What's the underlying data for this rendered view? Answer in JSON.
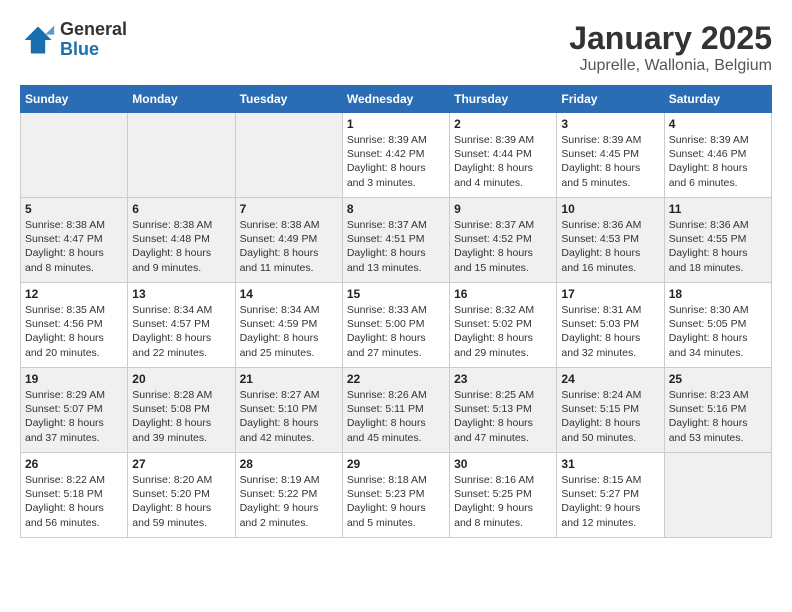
{
  "header": {
    "logo_general": "General",
    "logo_blue": "Blue",
    "month_title": "January 2025",
    "subtitle": "Juprelle, Wallonia, Belgium"
  },
  "weekdays": [
    "Sunday",
    "Monday",
    "Tuesday",
    "Wednesday",
    "Thursday",
    "Friday",
    "Saturday"
  ],
  "weeks": [
    [
      {
        "day": "",
        "info": ""
      },
      {
        "day": "",
        "info": ""
      },
      {
        "day": "",
        "info": ""
      },
      {
        "day": "1",
        "info": "Sunrise: 8:39 AM\nSunset: 4:42 PM\nDaylight: 8 hours\nand 3 minutes."
      },
      {
        "day": "2",
        "info": "Sunrise: 8:39 AM\nSunset: 4:44 PM\nDaylight: 8 hours\nand 4 minutes."
      },
      {
        "day": "3",
        "info": "Sunrise: 8:39 AM\nSunset: 4:45 PM\nDaylight: 8 hours\nand 5 minutes."
      },
      {
        "day": "4",
        "info": "Sunrise: 8:39 AM\nSunset: 4:46 PM\nDaylight: 8 hours\nand 6 minutes."
      }
    ],
    [
      {
        "day": "5",
        "info": "Sunrise: 8:38 AM\nSunset: 4:47 PM\nDaylight: 8 hours\nand 8 minutes."
      },
      {
        "day": "6",
        "info": "Sunrise: 8:38 AM\nSunset: 4:48 PM\nDaylight: 8 hours\nand 9 minutes."
      },
      {
        "day": "7",
        "info": "Sunrise: 8:38 AM\nSunset: 4:49 PM\nDaylight: 8 hours\nand 11 minutes."
      },
      {
        "day": "8",
        "info": "Sunrise: 8:37 AM\nSunset: 4:51 PM\nDaylight: 8 hours\nand 13 minutes."
      },
      {
        "day": "9",
        "info": "Sunrise: 8:37 AM\nSunset: 4:52 PM\nDaylight: 8 hours\nand 15 minutes."
      },
      {
        "day": "10",
        "info": "Sunrise: 8:36 AM\nSunset: 4:53 PM\nDaylight: 8 hours\nand 16 minutes."
      },
      {
        "day": "11",
        "info": "Sunrise: 8:36 AM\nSunset: 4:55 PM\nDaylight: 8 hours\nand 18 minutes."
      }
    ],
    [
      {
        "day": "12",
        "info": "Sunrise: 8:35 AM\nSunset: 4:56 PM\nDaylight: 8 hours\nand 20 minutes."
      },
      {
        "day": "13",
        "info": "Sunrise: 8:34 AM\nSunset: 4:57 PM\nDaylight: 8 hours\nand 22 minutes."
      },
      {
        "day": "14",
        "info": "Sunrise: 8:34 AM\nSunset: 4:59 PM\nDaylight: 8 hours\nand 25 minutes."
      },
      {
        "day": "15",
        "info": "Sunrise: 8:33 AM\nSunset: 5:00 PM\nDaylight: 8 hours\nand 27 minutes."
      },
      {
        "day": "16",
        "info": "Sunrise: 8:32 AM\nSunset: 5:02 PM\nDaylight: 8 hours\nand 29 minutes."
      },
      {
        "day": "17",
        "info": "Sunrise: 8:31 AM\nSunset: 5:03 PM\nDaylight: 8 hours\nand 32 minutes."
      },
      {
        "day": "18",
        "info": "Sunrise: 8:30 AM\nSunset: 5:05 PM\nDaylight: 8 hours\nand 34 minutes."
      }
    ],
    [
      {
        "day": "19",
        "info": "Sunrise: 8:29 AM\nSunset: 5:07 PM\nDaylight: 8 hours\nand 37 minutes."
      },
      {
        "day": "20",
        "info": "Sunrise: 8:28 AM\nSunset: 5:08 PM\nDaylight: 8 hours\nand 39 minutes."
      },
      {
        "day": "21",
        "info": "Sunrise: 8:27 AM\nSunset: 5:10 PM\nDaylight: 8 hours\nand 42 minutes."
      },
      {
        "day": "22",
        "info": "Sunrise: 8:26 AM\nSunset: 5:11 PM\nDaylight: 8 hours\nand 45 minutes."
      },
      {
        "day": "23",
        "info": "Sunrise: 8:25 AM\nSunset: 5:13 PM\nDaylight: 8 hours\nand 47 minutes."
      },
      {
        "day": "24",
        "info": "Sunrise: 8:24 AM\nSunset: 5:15 PM\nDaylight: 8 hours\nand 50 minutes."
      },
      {
        "day": "25",
        "info": "Sunrise: 8:23 AM\nSunset: 5:16 PM\nDaylight: 8 hours\nand 53 minutes."
      }
    ],
    [
      {
        "day": "26",
        "info": "Sunrise: 8:22 AM\nSunset: 5:18 PM\nDaylight: 8 hours\nand 56 minutes."
      },
      {
        "day": "27",
        "info": "Sunrise: 8:20 AM\nSunset: 5:20 PM\nDaylight: 8 hours\nand 59 minutes."
      },
      {
        "day": "28",
        "info": "Sunrise: 8:19 AM\nSunset: 5:22 PM\nDaylight: 9 hours\nand 2 minutes."
      },
      {
        "day": "29",
        "info": "Sunrise: 8:18 AM\nSunset: 5:23 PM\nDaylight: 9 hours\nand 5 minutes."
      },
      {
        "day": "30",
        "info": "Sunrise: 8:16 AM\nSunset: 5:25 PM\nDaylight: 9 hours\nand 8 minutes."
      },
      {
        "day": "31",
        "info": "Sunrise: 8:15 AM\nSunset: 5:27 PM\nDaylight: 9 hours\nand 12 minutes."
      },
      {
        "day": "",
        "info": ""
      }
    ]
  ]
}
